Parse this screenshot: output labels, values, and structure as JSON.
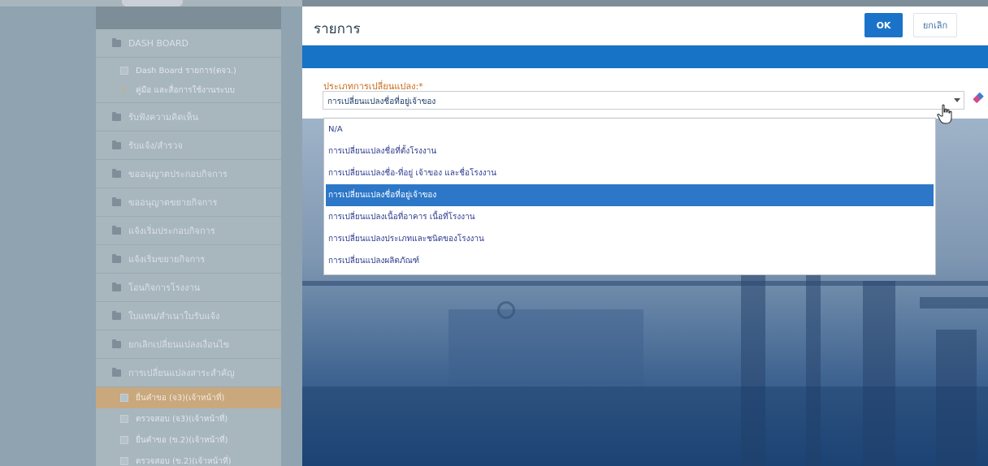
{
  "sidebar": {
    "groups": [
      {
        "label": "DASH BOARD"
      },
      {
        "label": "รับฟังความคิดเห็น"
      },
      {
        "label": "รับแจ้ง/สำรวจ"
      },
      {
        "label": "ขออนุญาตประกอบกิจการ"
      },
      {
        "label": "ขออนุญาตขยายกิจการ"
      },
      {
        "label": "แจ้งเริ่มประกอบกิจการ"
      },
      {
        "label": "แจ้งเริ่มขยายกิจการ"
      },
      {
        "label": "โอนกิจการโรงงาน"
      },
      {
        "label": "ใบแทน/สำเนาใบรับแจ้ง"
      },
      {
        "label": "ยกเลิกเปลี่ยนแปลงเงื่อนไข"
      },
      {
        "label": "การเปลี่ยนแปลงสาระสำคัญ"
      }
    ],
    "dashboard_items": [
      {
        "label": "Dash Board รายการ(ตจว.)"
      },
      {
        "label": "คู่มือ และสื่อการใช้งานระบบ"
      }
    ],
    "sub_items": [
      {
        "label": "ยื่นคำขอ (จ3)(เจ้าหน้าที่)"
      },
      {
        "label": "ตรวจสอบ (จ3)(เจ้าหน้าที่)"
      },
      {
        "label": "ยื่นคำขอ (ข.2)(เจ้าหน้าที่)"
      },
      {
        "label": "ตรวจสอบ (ข.2)(เจ้าหน้าที่)"
      }
    ]
  },
  "dialog": {
    "title": "รายการ",
    "ok_label": "OK",
    "cancel_label": "ยกเลิก",
    "field_label": "ประเภทการเปลี่ยนแปลง:*",
    "selected_value": "การเปลี่ยนแปลงชื่อที่อยู่เจ้าของ",
    "options": [
      {
        "label": "N/A"
      },
      {
        "label": "การเปลี่ยนแปลงชื่อที่ตั้งโรงงาน"
      },
      {
        "label": "การเปลี่ยนแปลงชื่อ-ที่อยู่ เจ้าของ และชื่อโรงงาน"
      },
      {
        "label": "การเปลี่ยนแปลงชื่อที่อยู่เจ้าของ"
      },
      {
        "label": "การเปลี่ยนแปลงเนื้อที่อาคาร เนื้อที่โรงงาน"
      },
      {
        "label": "การเปลี่ยนแปลงประเภทและชนิดของโรงงาน"
      },
      {
        "label": "การเปลี่ยนแปลงผลิตภัณฑ์"
      }
    ],
    "selected_index": 3
  },
  "colors": {
    "accent": "#1a73c8",
    "band": "#1673c5",
    "label": "#c66a17",
    "selected_option": "#2d77c9",
    "active_menu": "#c9a87e"
  },
  "icons": {
    "folder": "folder-icon",
    "doc": "document-icon",
    "pen": "edit-icon",
    "arrow": "chevron-down-icon",
    "eraser": "eraser-icon",
    "cursor": "hand-pointer-icon"
  }
}
